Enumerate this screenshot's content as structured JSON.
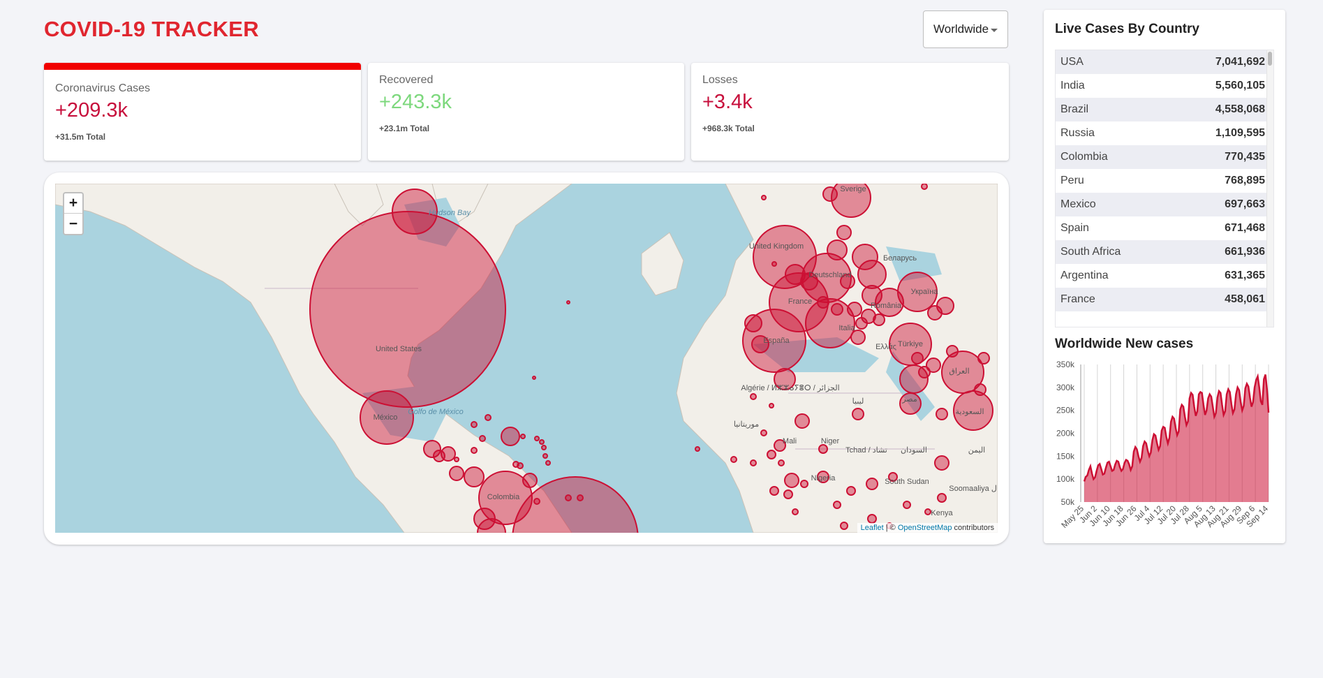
{
  "app": {
    "title": "COVID-19 TRACKER"
  },
  "country_select": {
    "value": "Worldwide"
  },
  "stats": [
    {
      "label": "Coronavirus Cases",
      "value": "+209.3k",
      "total": "+31.5m Total",
      "color": "#c70f3c",
      "active": true
    },
    {
      "label": "Recovered",
      "value": "+243.3k",
      "total": "+23.1m Total",
      "color": "#7dd87d",
      "active": false
    },
    {
      "label": "Losses",
      "value": "+3.4k",
      "total": "+968.3k Total",
      "color": "#c70f3c",
      "active": false
    }
  ],
  "map": {
    "zoom_in": "+",
    "zoom_out": "−",
    "attribution": {
      "leaflet": "Leaflet",
      "sep": " | © ",
      "osm": "OpenStreetMap",
      "contributors": " contributors"
    },
    "labels": [
      "United States",
      "México",
      "Colombia",
      "España",
      "France",
      "United Kingdom",
      "Deutschland",
      "Italia",
      "Sverige",
      "România",
      "Україна",
      "Беларусь",
      "Türkiye",
      "Ελλάς",
      "Algérie / ⵍⵣⵣⴰⵢⴻⵔ / الجزائر",
      "موريتانيا",
      "Mali",
      "Niger",
      "Tchad / تشاد",
      "السودان",
      "Nigeria",
      "South Sudan",
      "Kenya",
      "Soomaaliya الصومال",
      "مصر",
      "العراق",
      "السعودية",
      "اليمن",
      "ليبيا",
      "Hudson Bay",
      "Golfo de México"
    ],
    "circle_color": "#cc1034"
  },
  "live_cases": {
    "title": "Live Cases By Country",
    "rows": [
      {
        "country": "USA",
        "cases": "7,041,692"
      },
      {
        "country": "India",
        "cases": "5,560,105"
      },
      {
        "country": "Brazil",
        "cases": "4,558,068"
      },
      {
        "country": "Russia",
        "cases": "1,109,595"
      },
      {
        "country": "Colombia",
        "cases": "770,435"
      },
      {
        "country": "Peru",
        "cases": "768,895"
      },
      {
        "country": "Mexico",
        "cases": "697,663"
      },
      {
        "country": "Spain",
        "cases": "671,468"
      },
      {
        "country": "South Africa",
        "cases": "661,936"
      },
      {
        "country": "Argentina",
        "cases": "631,365"
      },
      {
        "country": "France",
        "cases": "458,061"
      }
    ]
  },
  "new_cases_graph": {
    "title": "Worldwide New cases"
  },
  "chart_data": {
    "type": "area",
    "title": "Worldwide New cases",
    "xlabel": "",
    "ylabel": "",
    "ylim": [
      50000,
      350000
    ],
    "y_ticks": [
      "50k",
      "100k",
      "150k",
      "200k",
      "250k",
      "300k",
      "350k"
    ],
    "x_ticks": [
      "May 25",
      "Jun 2",
      "Jun 10",
      "Jun 18",
      "Jun 26",
      "Jul 4",
      "Jul 12",
      "Jul 20",
      "Jul 28",
      "Aug 5",
      "Aug 13",
      "Aug 21",
      "Aug 29",
      "Sep 6",
      "Sep 14"
    ],
    "color": "#cc1034",
    "fill": "rgba(204,16,52,0.55)",
    "series": [
      {
        "values": [
          95000,
          105000,
          108000,
          120000,
          128000,
          112000,
          100000,
          104000,
          118000,
          130000,
          133000,
          122000,
          110000,
          112000,
          125000,
          136000,
          138000,
          128000,
          118000,
          120000,
          132000,
          140000,
          138000,
          126000,
          118000,
          122000,
          135000,
          142000,
          140000,
          132000,
          120000,
          128000,
          160000,
          170000,
          165000,
          150000,
          138000,
          146000,
          172000,
          182000,
          178000,
          162000,
          150000,
          158000,
          185000,
          198000,
          195000,
          178000,
          164000,
          172000,
          206000,
          214000,
          212000,
          192000,
          178000,
          190000,
          225000,
          236000,
          232000,
          212000,
          196000,
          204000,
          252000,
          262000,
          258000,
          236000,
          218000,
          226000,
          276000,
          288000,
          284000,
          258000,
          238000,
          248000,
          285000,
          290000,
          288000,
          262000,
          240000,
          250000,
          276000,
          285000,
          280000,
          258000,
          236000,
          244000,
          278000,
          292000,
          288000,
          262000,
          240000,
          248000,
          285000,
          296000,
          290000,
          264000,
          244000,
          252000,
          285000,
          300000,
          294000,
          268000,
          250000,
          260000,
          298000,
          308000,
          302000,
          278000,
          258000,
          268000,
          300000,
          316000,
          324000,
          300000,
          270000,
          262000,
          318000,
          328000,
          296000,
          245000
        ]
      }
    ]
  }
}
